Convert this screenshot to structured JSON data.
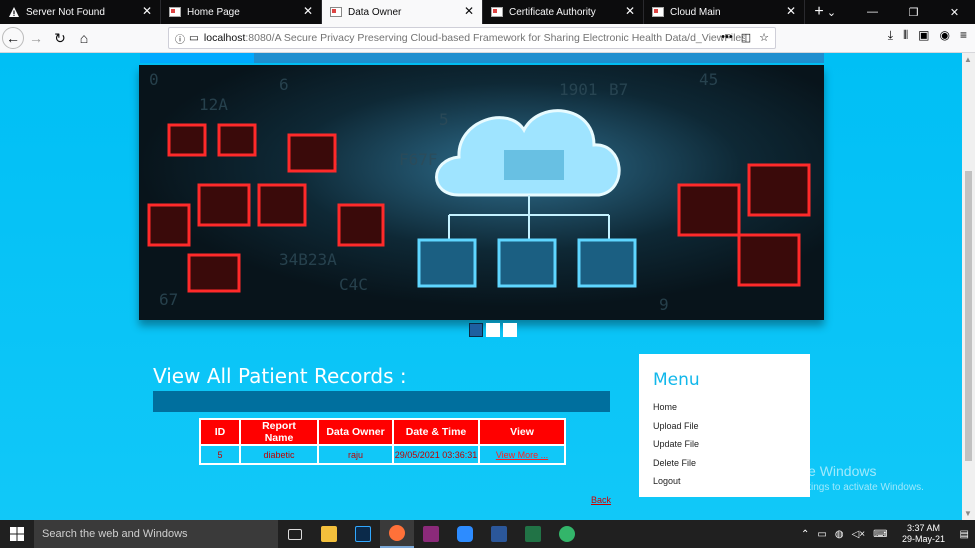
{
  "tabs": [
    {
      "label": "Server Not Found",
      "active": false
    },
    {
      "label": "Home Page",
      "active": false
    },
    {
      "label": "Data Owner",
      "active": true
    },
    {
      "label": "Certificate Authority",
      "active": false
    },
    {
      "label": "Cloud Main",
      "active": false
    }
  ],
  "url": {
    "host": "localhost",
    "path": ":8080/A Secure Privacy Preserving Cloud-based Framework for Sharing Electronic Health Data/d_ViewFiles..."
  },
  "page": {
    "heading": "View All Patient Records :",
    "table": {
      "headers": [
        "ID",
        "Report Name",
        "Data Owner",
        "Date & Time",
        "View"
      ],
      "rows": [
        {
          "id": "5",
          "report_name": "diabetic",
          "data_owner": "raju",
          "datetime": "29/05/2021 03:36:31",
          "view": "View More ..."
        }
      ]
    },
    "back_link": "Back",
    "menu": {
      "title": "Menu",
      "items": [
        "Home",
        "Upload File",
        "Update File",
        "Delete File",
        "Logout"
      ]
    },
    "slider_dots": [
      true,
      false,
      false
    ]
  },
  "watermark": {
    "line1": "Activate Windows",
    "line2": "Go to Settings to activate Windows."
  },
  "taskbar": {
    "search_placeholder": "Search the web and Windows",
    "time": "3:37 AM",
    "date": "29-May-21"
  },
  "colors": {
    "page_bg": "#0cc3f7",
    "table_header": "#ff0000",
    "heading_bar": "#006f9e",
    "menu_title": "#11b7ea"
  }
}
